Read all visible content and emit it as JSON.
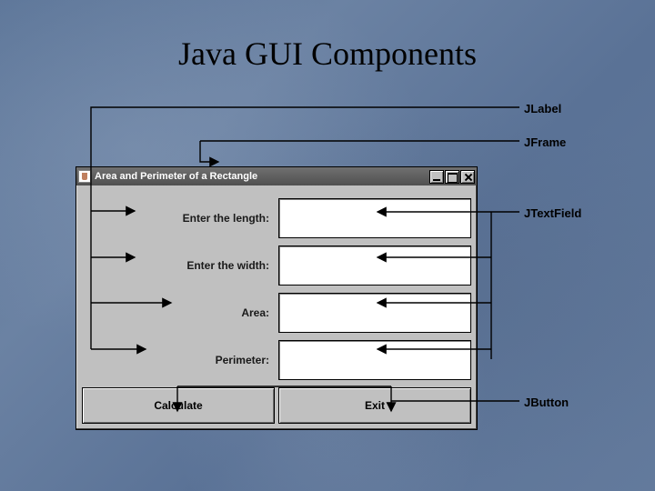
{
  "slide": {
    "title": "Java GUI Components"
  },
  "annotations": {
    "jlabel": "JLabel",
    "jframe": "JFrame",
    "jtextfield": "JTextField",
    "jbutton": "JButton"
  },
  "window": {
    "title": "Area and Perimeter of a Rectangle",
    "labels": {
      "length": "Enter the length:",
      "width": "Enter the width:",
      "area": "Area:",
      "perimeter": "Perimeter:"
    },
    "fields": {
      "length": "",
      "width": "",
      "area": "",
      "perimeter": ""
    },
    "buttons": {
      "calculate": "Calculate",
      "exit": "Exit"
    }
  }
}
